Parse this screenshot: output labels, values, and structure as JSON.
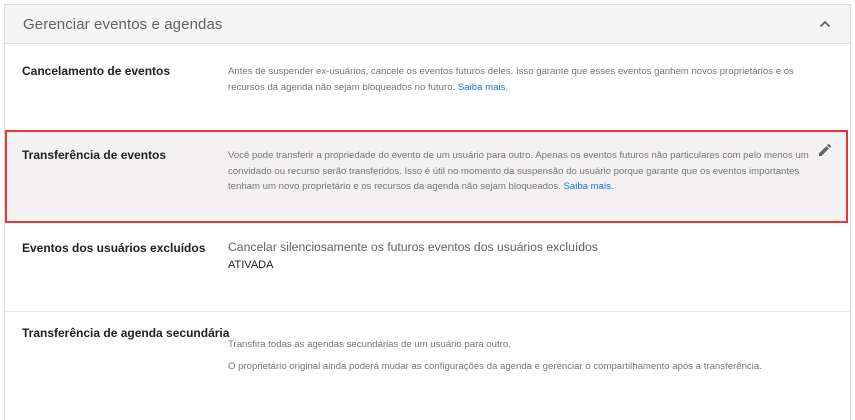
{
  "header": {
    "title": "Gerenciar eventos e agendas",
    "collapse_icon": "chevron-up-icon"
  },
  "sections": {
    "cancellation": {
      "label": "Cancelamento de eventos",
      "description": "Antes de suspender ex-usuários, cancele os eventos futuros deles. Isso garante que esses eventos ganhem novos proprietários e os recursos da agenda não sejam bloqueados no futuro.",
      "link": "Saiba mais."
    },
    "transfer": {
      "label": "Transferência de eventos",
      "description": "Você pode transferir a propriedade do evento de um usuário para outro. Apenas os eventos futuros não particulares com pelo menos um convidado ou recurso serão transferidos. Isso é útil no momento da suspensão do usuário porque garante que os eventos importantes tenham um novo proprietário e os recursos da agenda não sejam bloqueados.",
      "link": "Saiba mais.",
      "edit_icon": "pencil-icon",
      "highlight_color": "#e53935"
    },
    "deleted_users": {
      "label": "Eventos dos usuários excluídos",
      "description": "Cancelar silenciosamente os futuros eventos dos usuários excluídos",
      "status": "ATIVADA"
    },
    "secondary_calendar": {
      "label": "Transferência de agenda secundária",
      "line1": "Transfira todas as agendas secundárias de um usuário para outro.",
      "line2": "O proprietário original ainda poderá mudar as configurações da agenda e gerenciar o compartilhamento após a transferência."
    }
  },
  "colors": {
    "link": "#1a73e8",
    "header_bg": "#f5f5f5",
    "highlight_bg": "#f3f1f2"
  }
}
